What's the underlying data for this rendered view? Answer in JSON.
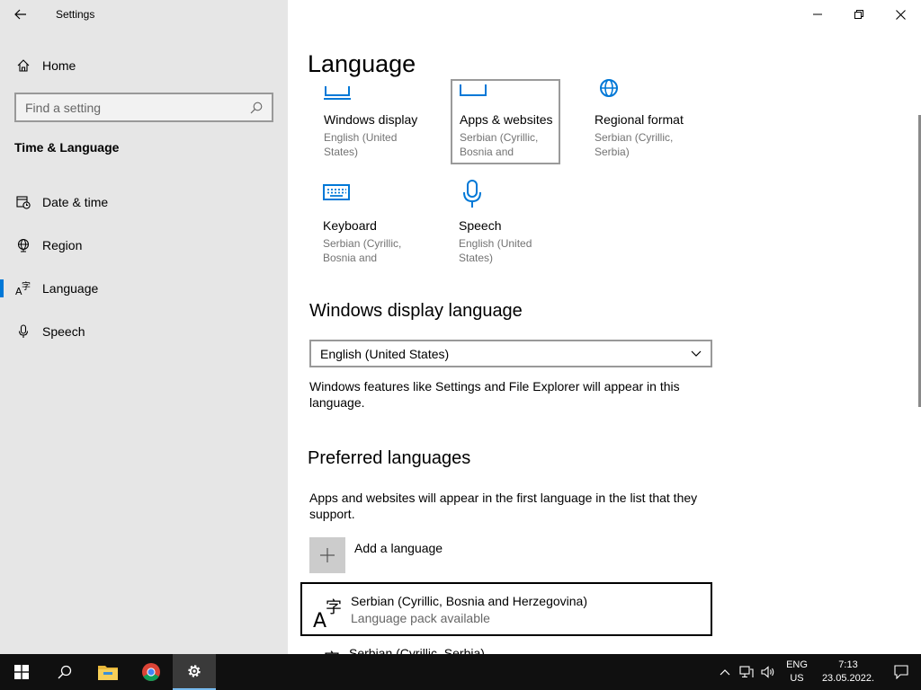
{
  "window": {
    "title": "Settings"
  },
  "sidebar": {
    "home_label": "Home",
    "search_placeholder": "Find a setting",
    "section_title": "Time & Language",
    "items": [
      {
        "label": "Date & time",
        "icon": "calendar-clock-icon"
      },
      {
        "label": "Region",
        "icon": "globe-icon"
      },
      {
        "label": "Language",
        "icon": "language-icon",
        "active": true
      },
      {
        "label": "Speech",
        "icon": "microphone-icon"
      }
    ]
  },
  "main": {
    "title": "Language",
    "tiles": [
      {
        "name": "Windows display",
        "sub": "English (United States)",
        "icon": "monitor-icon"
      },
      {
        "name": "Apps & websites",
        "sub": "Serbian (Cyrillic, Bosnia and",
        "icon": "window-icon"
      },
      {
        "name": "Regional format",
        "sub": "Serbian (Cyrillic, Serbia)",
        "icon": "globe-icon"
      },
      {
        "name": "Keyboard",
        "sub": "Serbian (Cyrillic, Bosnia and",
        "icon": "keyboard-icon"
      },
      {
        "name": "Speech",
        "sub": "English (United States)",
        "icon": "microphone-icon"
      }
    ],
    "display_language": {
      "heading": "Windows display language",
      "selected": "English (United States)",
      "description": "Windows features like Settings and File Explorer will appear in this language."
    },
    "preferred": {
      "heading": "Preferred languages",
      "description": "Apps and websites will appear in the first language in the list that they support.",
      "add_label": "Add a language",
      "languages": [
        {
          "name": "Serbian (Cyrillic, Bosnia and Herzegovina)",
          "status": "Language pack available"
        },
        {
          "name": "Serbian (Cyrillic, Serbia)",
          "status": ""
        }
      ]
    }
  },
  "taskbar": {
    "lang_line1": "ENG",
    "lang_line2": "US",
    "time": "7:13",
    "date": "23.05.2022."
  },
  "colors": {
    "accent": "#0078d7",
    "sidebar_bg": "#e6e6e6",
    "taskbar_bg": "#101010"
  }
}
